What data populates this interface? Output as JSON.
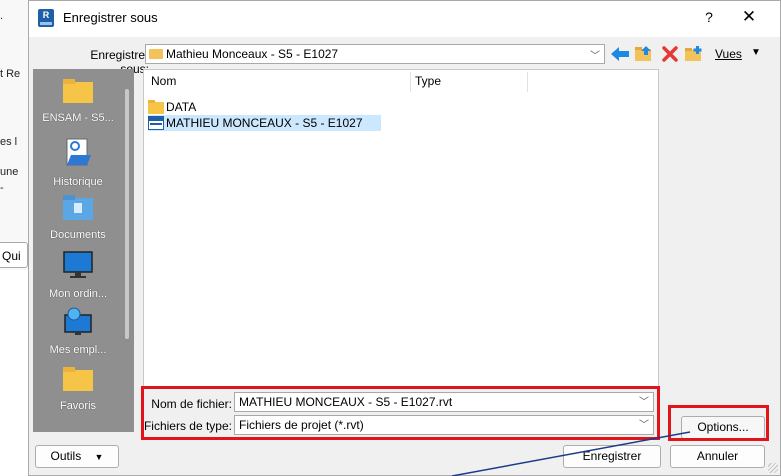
{
  "background": {
    "fragments": [
      ".",
      "t Re",
      "es l",
      "une",
      "-"
    ],
    "button_fragment": "Qui"
  },
  "dialog": {
    "title": "Enregistrer sous",
    "help": "?",
    "close": "✕",
    "save_in_label": "Enregistrer sous:",
    "location": "Mathieu Monceaux - S5 - E1027",
    "views_label": "Vues"
  },
  "places": [
    {
      "label": "ENSAM - S5...",
      "icon": "folder-icon"
    },
    {
      "label": "Historique",
      "icon": "history-icon"
    },
    {
      "label": "Documents",
      "icon": "documents-folder-icon"
    },
    {
      "label": "Mon ordin...",
      "icon": "computer-icon"
    },
    {
      "label": "Mes empl...",
      "icon": "network-places-icon"
    },
    {
      "label": "Favoris",
      "icon": "favorites-folder-icon"
    }
  ],
  "file_list": {
    "columns": [
      "Nom",
      "Type"
    ],
    "rows": [
      {
        "name": "DATA",
        "type": "",
        "icon": "folder-icon"
      },
      {
        "name": "MATHIEU MONCEAUX - S5 - E1027",
        "type": "",
        "icon": "rvt-file-icon",
        "selected": true
      }
    ]
  },
  "form": {
    "filename_label": "Nom de fichier:",
    "filename_value": "MATHIEU MONCEAUX - S5 - E1027.rvt",
    "filetype_label": "Fichiers de type:",
    "filetype_value": "Fichiers de projet  (*.rvt)"
  },
  "buttons": {
    "tools": "Outils",
    "options": "Options...",
    "save": "Enregistrer",
    "cancel": "Annuler"
  },
  "colors": {
    "highlight": "#e0141a",
    "selection": "#cce8ff",
    "places_bar": "#8f8f8f",
    "arrow_line": "#1a3a8a"
  }
}
